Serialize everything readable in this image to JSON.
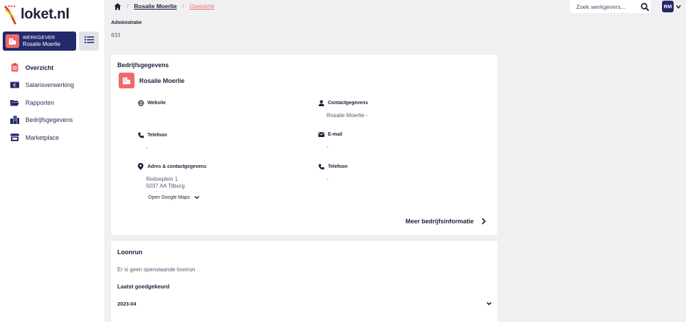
{
  "app": {
    "logo_text": "loket.nl"
  },
  "employer": {
    "kind": "WERKGEVER",
    "name": "Rosalie Moerlie"
  },
  "sidebar": {
    "items": [
      {
        "label": "Overzicht",
        "icon": "clipboard-icon"
      },
      {
        "label": "Salarisverwerking",
        "icon": "euro-banknote-icon"
      },
      {
        "label": "Rapporten",
        "icon": "folder-open-icon"
      },
      {
        "label": "Bedrijfsgegevens",
        "icon": "buildings-icon"
      },
      {
        "label": "Marketplace",
        "icon": "store-icon"
      }
    ]
  },
  "breadcrumb": {
    "employer": "Rosalie Moerlie",
    "current": "Overzicht",
    "separator": "/"
  },
  "search": {
    "placeholder": "Zoek werkgevers..."
  },
  "user": {
    "initials": "RM"
  },
  "administratie": {
    "label": "Administratie",
    "value": "833"
  },
  "company_card": {
    "title": "Bedrijfsgegevens",
    "company_name": "Rosalie Moerlie",
    "website": {
      "label": "Website",
      "value": ""
    },
    "telefoon_left": {
      "label": "Telefoon",
      "value": "-"
    },
    "adres": {
      "label": "Adres & contactgegevens",
      "line1": "Reitseplein 1",
      "line2": "5037 AA Tilburg",
      "maps": "Open Google Maps"
    },
    "contact": {
      "label": "Contactgegevens",
      "value": "Rosalie Moerlie -"
    },
    "email": {
      "label": "E-mail",
      "value": "-"
    },
    "telefoon_right": {
      "label": "Telefoon",
      "value": "-"
    },
    "more": "Meer bedrijfsinformatie"
  },
  "loonrun": {
    "title": "Loonrun",
    "empty_text": "Er is geen openstaande loonrun",
    "approved_label": "Laatst goedgekeurd",
    "approved_period": "2023-04"
  },
  "colors": {
    "navy": "#232a6b",
    "accent": "#f06a6a",
    "background": "#f0f0f1"
  }
}
